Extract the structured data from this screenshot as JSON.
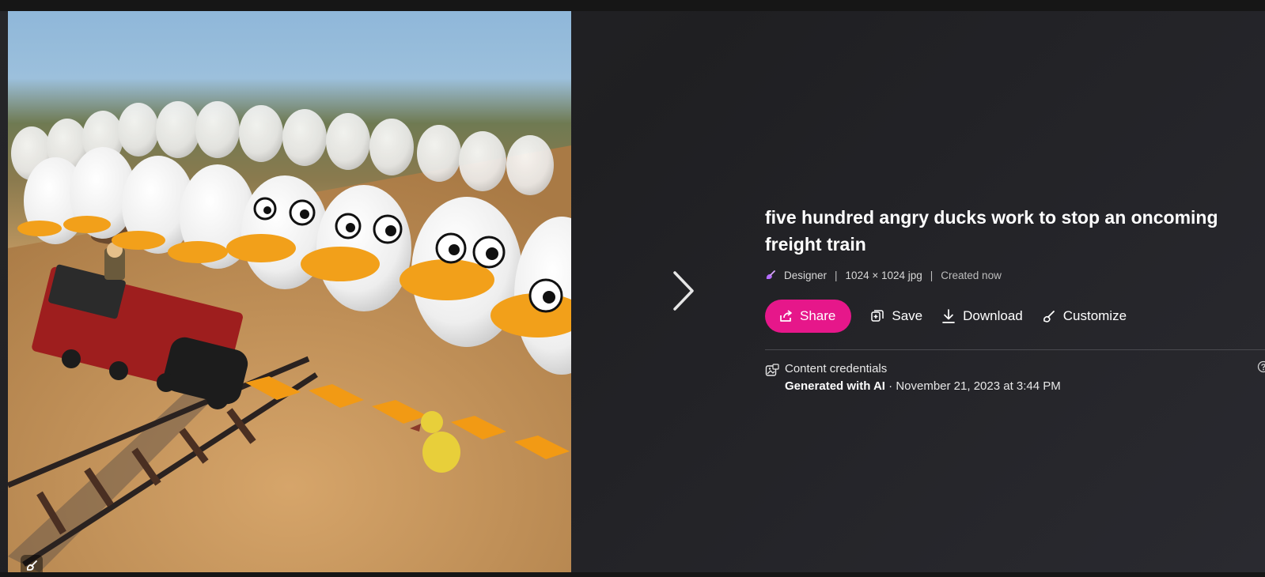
{
  "image": {
    "alt_icon": "designer-watermark-icon"
  },
  "navigation": {
    "next_icon": "chevron-right-icon"
  },
  "details": {
    "title": "five hundred angry ducks work to stop an oncoming freight train",
    "app_name": "Designer",
    "separator": "|",
    "dimensions": "1024 × 1024 jpg",
    "created": "Created now"
  },
  "actions": {
    "share_label": "Share",
    "save_label": "Save",
    "download_label": "Download",
    "customize_label": "Customize"
  },
  "credentials": {
    "title": "Content credentials",
    "generated": "Generated with AI",
    "dot": " · ",
    "timestamp": "November 21, 2023 at 3:44 PM"
  },
  "colors": {
    "share_bg": "#e6178a",
    "panel_bg": "#232326",
    "accent_icon": "#b46cff"
  }
}
